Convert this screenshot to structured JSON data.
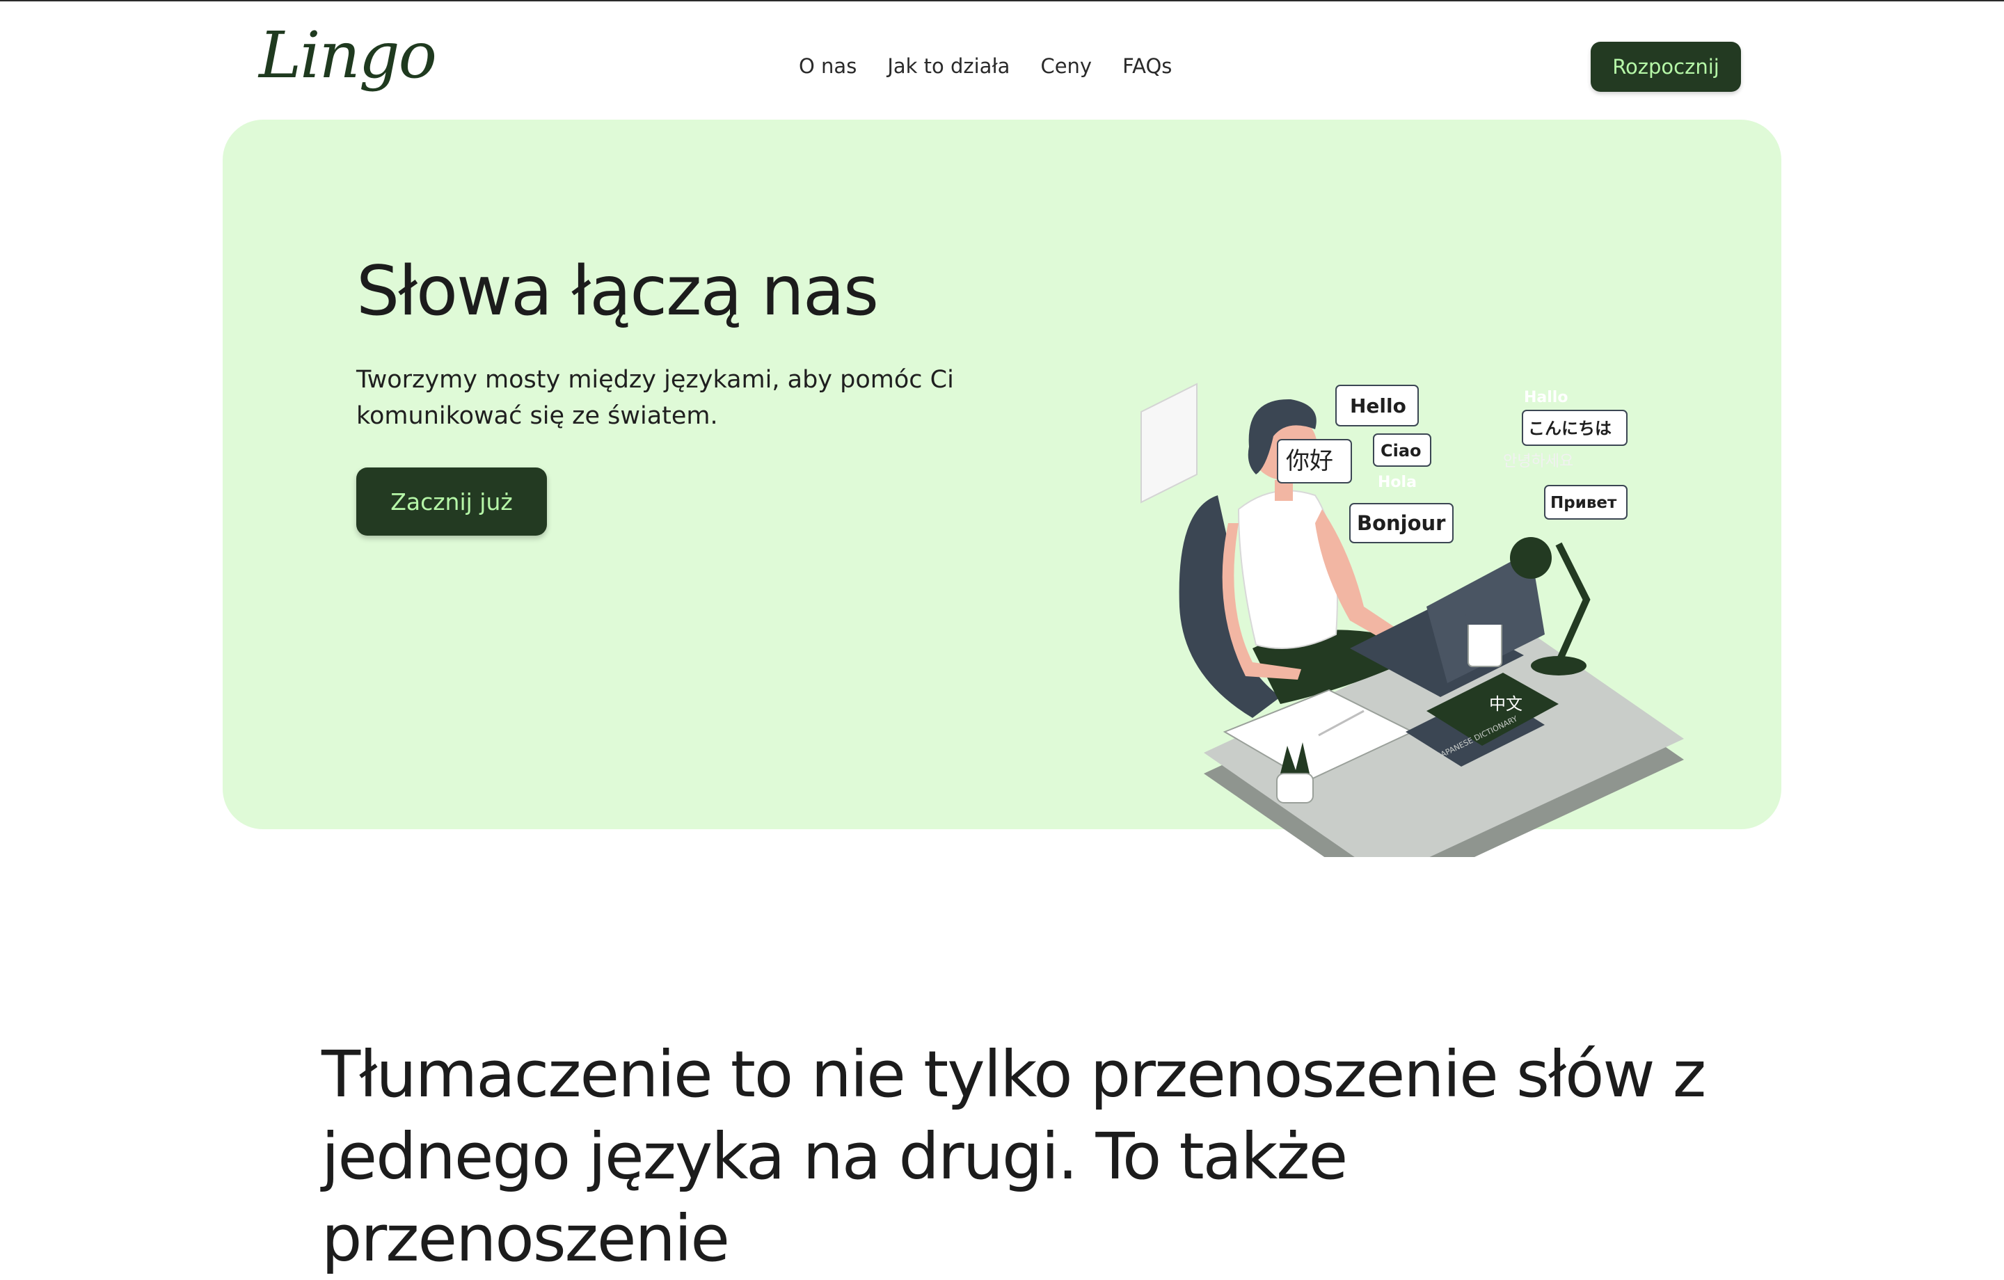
{
  "header": {
    "logo": "Lingo",
    "nav": [
      "O nas",
      "Jak to działa",
      "Ceny",
      "FAQs"
    ],
    "cta": "Rozpocznij"
  },
  "hero": {
    "title": "Słowa łączą nas",
    "subtitle": "Tworzymy mosty między językami, aby pomóc Ci komunikować się ze światem.",
    "cta": "Zacznij już",
    "illustration": {
      "greetings": [
        "Hello",
        "こんにちは",
        "你好",
        "Ciao",
        "Bonjour",
        "Привет"
      ],
      "faint_greetings": [
        "Hallo",
        "Hola",
        "안녕하세요"
      ],
      "book_label": "中文",
      "dictionary_label": "JAPANESE DICTIONARY"
    }
  },
  "section": {
    "heading": "Tłumaczenie to nie tylko przenoszenie słów z jednego języka na drugi. To także przenoszenie"
  },
  "colors": {
    "brand_dark": "#233a22",
    "brand_light": "#b6f7a8",
    "hero_bg": "#dffad7"
  }
}
